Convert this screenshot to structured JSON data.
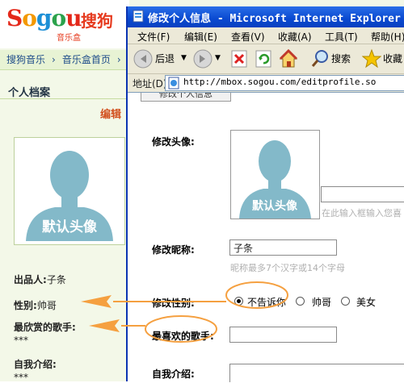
{
  "bg_page": {
    "logo": {
      "brand": "Sogou",
      "brand_cn": "搜狗",
      "sub": "音乐盒"
    },
    "breadcrumb": [
      "搜狗音乐",
      "›",
      "音乐盒首页",
      "›"
    ],
    "panel_title": "个人档案",
    "edit_link": "编辑",
    "avatar_caption": "默认头像",
    "producer_label": "出品人:",
    "producer_value": "子条",
    "gender_label": "性别:",
    "gender_value": "帅哥",
    "fav_singer_label": "最欣赏的歌手:",
    "fav_singer_value": "***",
    "intro_label": "自我介绍:",
    "intro_value": "***"
  },
  "browser": {
    "title": "修改个人信息 - Microsoft Internet Explorer",
    "menu": [
      "文件(F)",
      "编辑(E)",
      "查看(V)",
      "收藏(A)",
      "工具(T)",
      "帮助(H)"
    ],
    "toolbar": {
      "back": "后退",
      "search": "搜索",
      "favorites": "收藏"
    },
    "address_label": "地址(D)",
    "address_url": "http://mbox.sogou.com/editprofile.so"
  },
  "form": {
    "tab_label": "修改个人信息",
    "avatar_label": "修改头像:",
    "avatar_caption": "默认头像",
    "avatar_input_hint": "在此输入框输入您喜",
    "nickname_label": "修改昵称:",
    "nickname_value": "子条",
    "nickname_hint": "昵称最多7个汉字或14个字母",
    "gender_label": "修改性别:",
    "gender_options": [
      {
        "label": "不告诉你",
        "checked": true
      },
      {
        "label": "帅哥",
        "checked": false
      },
      {
        "label": "美女",
        "checked": false
      }
    ],
    "fav_singer_label": "最喜欢的歌手:",
    "fav_singer_value": "",
    "intro_label": "自我介绍:"
  },
  "colors": {
    "annotation": "#f5a040",
    "title_bar": "#0a49d0",
    "accent_red": "#e4281a"
  }
}
